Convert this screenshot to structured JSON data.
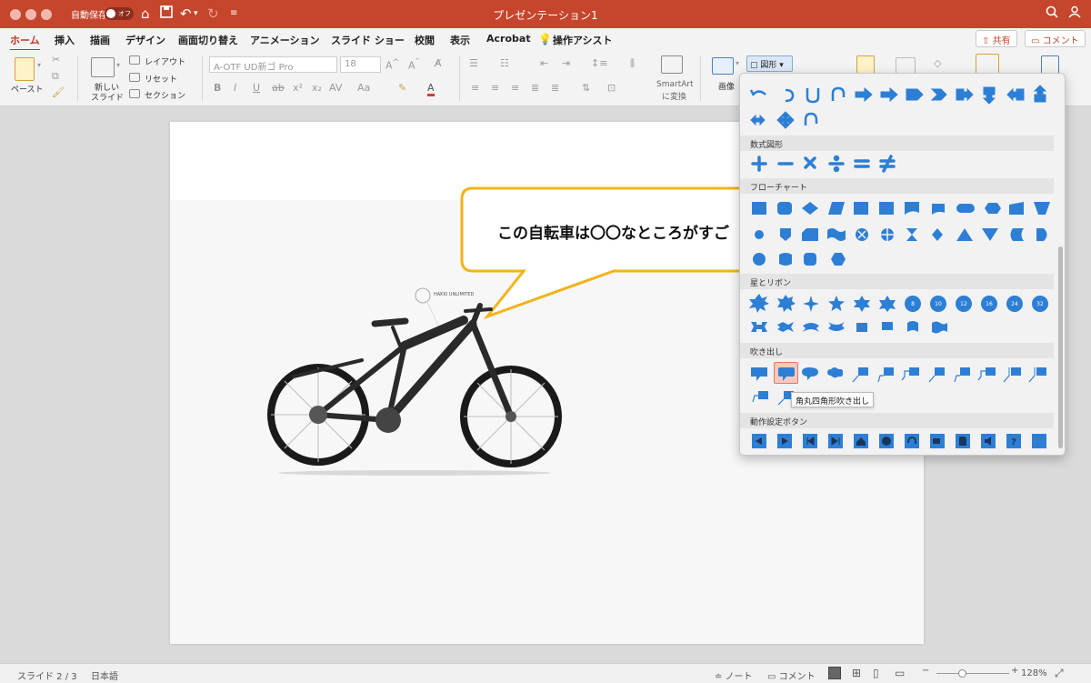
{
  "window": {
    "title": "プレゼンテーション1",
    "autosave_label": "自動保存",
    "autosave_state": "オフ"
  },
  "menu": {
    "tabs": [
      "ホーム",
      "挿入",
      "描画",
      "デザイン",
      "画面切り替え",
      "アニメーション",
      "スライド ショー",
      "校閲",
      "表示",
      "Acrobat",
      "操作アシスト"
    ],
    "share": "共有",
    "comment": "コメント"
  },
  "ribbon": {
    "paste": "ペースト",
    "new_slide_line1": "新しい",
    "new_slide_line2": "スライド",
    "layout": "レイアウト",
    "reset": "リセット",
    "section": "セクション",
    "font_name": "A-OTF UD新ゴ Pro",
    "font_size": "18",
    "smartart_line1": "SmartArt",
    "smartart_line2": "に変換",
    "picture": "画像",
    "shapes": "図形"
  },
  "slide": {
    "callout_text": "この自転車は〇〇なところがすご",
    "bike_logo": "HAKKI UNLIMITED"
  },
  "shapes_panel": {
    "sections": [
      "数式図形",
      "フローチャート",
      "星とリボン",
      "吹き出し",
      "動作設定ボタン"
    ],
    "tooltip": "角丸四角形吹き出し",
    "star_numbers": [
      "8",
      "10",
      "12",
      "16",
      "24",
      "32"
    ],
    "accent_color": "#2d7fd6"
  },
  "statusbar": {
    "slide_info": "スライド 2 / 3",
    "language": "日本語",
    "notes": "ノート",
    "comments": "コメント",
    "zoom": "128%"
  }
}
